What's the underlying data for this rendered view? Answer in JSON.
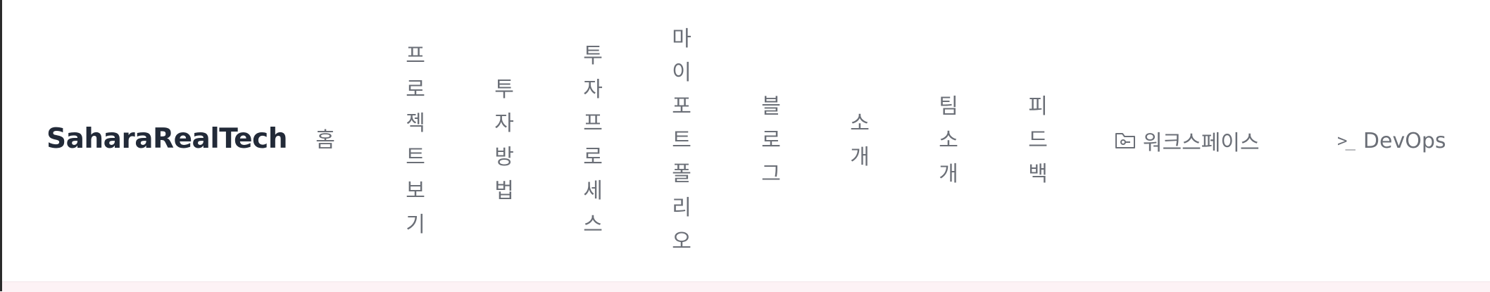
{
  "brand": {
    "name": "SaharaRealTech"
  },
  "nav": {
    "home": "홈",
    "projects": "프로젝트보기",
    "invest_method": "투자방법",
    "invest_process": "투자프로세스",
    "my_portfolio": "마이포트폴리오",
    "blog": "블로그",
    "about": "소개",
    "team": "팀소개",
    "feedback": "피드백",
    "workspace": "워크스페이스",
    "devops": "DevOps"
  },
  "icons": {
    "workspace": "folder-icon",
    "devops": "terminal-icon"
  },
  "colors": {
    "brand_text": "#222a38",
    "nav_text": "#6b6f77",
    "content_bg_tint": "#fdf2f5"
  }
}
